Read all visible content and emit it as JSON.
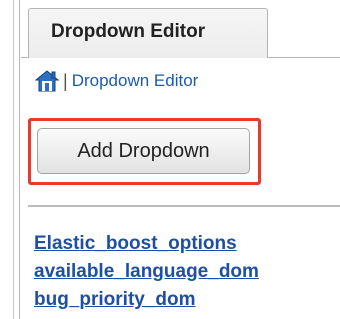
{
  "tab": {
    "label": "Dropdown Editor"
  },
  "breadcrumb": {
    "home_icon": "home-icon",
    "separator": "|",
    "current": "Dropdown Editor"
  },
  "actions": {
    "add_label": "Add Dropdown"
  },
  "dropdown_list": [
    "Elastic_boost_options",
    "available_language_dom",
    "bug_priority_dom"
  ],
  "colors": {
    "link": "#1f5aa8",
    "highlight": "#e8392c"
  }
}
